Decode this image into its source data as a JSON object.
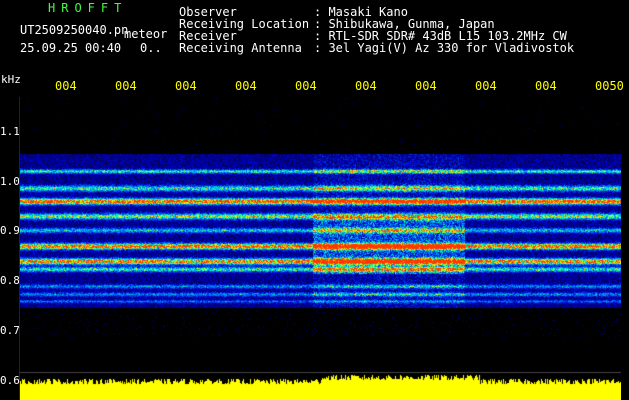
{
  "header": {
    "app_name": "HROFFT",
    "file_name": "UT2509250040.pn",
    "meteor_label": "meteor",
    "date_time": "25.09.25 00:40",
    "count_value": "0.."
  },
  "info": {
    "rows": [
      {
        "label": "Observer",
        "value": ": Masaki Kano"
      },
      {
        "label": "Receiving Location",
        "value": ": Shibukawa, Gunma, Japan"
      },
      {
        "label": "Receiver",
        "value": ": RTL-SDR SDR# 43dB L15 103.2MHz CW"
      },
      {
        "label": "Receiving Antenna",
        "value": ": 3el Yagi(V) Az 330 for Vladivostok"
      }
    ]
  },
  "axes": {
    "y_unit": "kHz",
    "y_ticks": [
      "1.1",
      "1.0",
      "0.9",
      "0.8",
      "0.7",
      "0.6"
    ],
    "x_ticks": [
      "004",
      "004",
      "004",
      "004",
      "004",
      "004",
      "004",
      "004",
      "004",
      "0050"
    ]
  },
  "colors": {
    "header_text": "#ffffff",
    "app_name": "#3cff3c",
    "x_ticks": "#ffff00",
    "waveform": "#ffff00",
    "background": "#000000"
  }
}
